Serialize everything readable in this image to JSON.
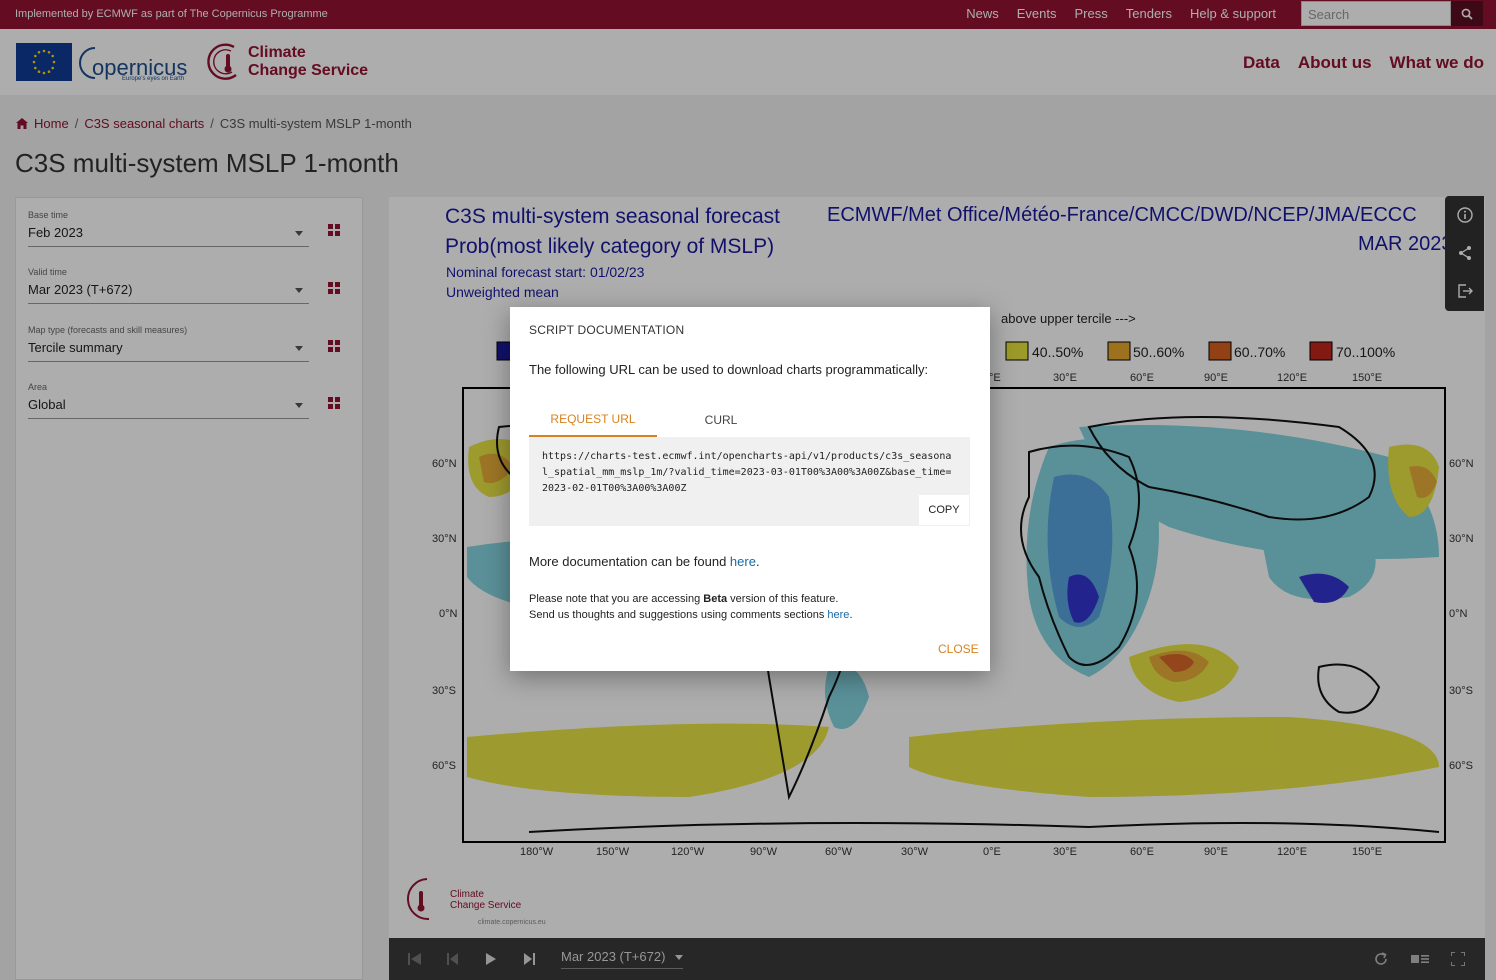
{
  "topbar": {
    "implemented_text": "Implemented by ECMWF as part of The Copernicus Programme",
    "links": [
      "News",
      "Events",
      "Press",
      "Tenders",
      "Help & support"
    ],
    "search_placeholder": "Search"
  },
  "header": {
    "copernicus_word": "opernicus",
    "copernicus_tagline": "Europe's eyes on Earth",
    "ccs_line1": "Climate",
    "ccs_line2": "Change Service",
    "nav": [
      "Data",
      "About us",
      "What we do"
    ],
    "brand_color": "#941333"
  },
  "breadcrumb": {
    "home": "Home",
    "parent": "C3S seasonal charts",
    "current": "C3S multi-system MSLP 1-month"
  },
  "page_title": "C3S multi-system MSLP 1-month",
  "sidebar": {
    "fields": [
      {
        "label": "Base time",
        "value": "Feb 2023"
      },
      {
        "label": "Valid time",
        "value": "Mar 2023 (T+672)"
      },
      {
        "label": "Map type (forecasts and skill measures)",
        "value": "Tercile summary"
      },
      {
        "label": "Area",
        "value": "Global"
      }
    ]
  },
  "chart": {
    "title_line1": "C3S multi-system seasonal forecast",
    "title_line2": "Prob(most likely category of MSLP)",
    "subtitle_line1": "Nominal forecast start: 01/02/23",
    "subtitle_line2": "Unweighted mean",
    "centres": "ECMWF/Met Office/Météo-France/CMCC/DWD/NCEP/JMA/ECCC",
    "valid_label": "MAR 2023",
    "legend_heading": "above upper tercile --->",
    "legend_items": [
      {
        "label": "40..50%",
        "color": "#e6e33c"
      },
      {
        "label": "50..60%",
        "color": "#e7a92e"
      },
      {
        "label": "60..70%",
        "color": "#d8601e"
      },
      {
        "label": "70..100%",
        "color": "#c0271d"
      }
    ],
    "lat_labels": [
      "60°N",
      "30°N",
      "0°N",
      "30°S",
      "60°S"
    ],
    "lon_labels_bottom": [
      "180°W",
      "150°W",
      "120°W",
      "90°W",
      "60°W",
      "30°W",
      "0°E",
      "30°E",
      "60°E",
      "90°E",
      "120°E",
      "150°E"
    ],
    "lon_labels_top": [
      "°E",
      "30°E",
      "60°E",
      "90°E",
      "120°E",
      "150°E"
    ],
    "footer_logo_line1": "Climate",
    "footer_logo_line2": "Change Service",
    "footer_url": "climate.copernicus.eu"
  },
  "player": {
    "selected": "Mar 2023 (T+672)"
  },
  "modal": {
    "title": "SCRIPT DOCUMENTATION",
    "intro": "The following URL can be used to download charts programmatically:",
    "tab_request": "REQUEST URL",
    "tab_curl": "CURL",
    "url": "https://charts-test.ecmwf.int/opencharts-api/v1/products/c3s_seasonal_spatial_mm_mslp_1m/?valid_time=2023-03-01T00%3A00%3A00Z&base_time=2023-02-01T00%3A00%3A00Z",
    "copy_label": "COPY",
    "more_doc_prefix": "More documentation can be found ",
    "more_doc_link": "here",
    "more_doc_suffix": ".",
    "note_prefix": "Please note that you are accessing ",
    "note_bold": "Beta",
    "note_suffix": " version of this feature.",
    "note_line2_prefix": "Send us thoughts and suggestions using comments sections ",
    "note_line2_link": "here",
    "close_label": "CLOSE",
    "accent_color": "#d7831d"
  }
}
